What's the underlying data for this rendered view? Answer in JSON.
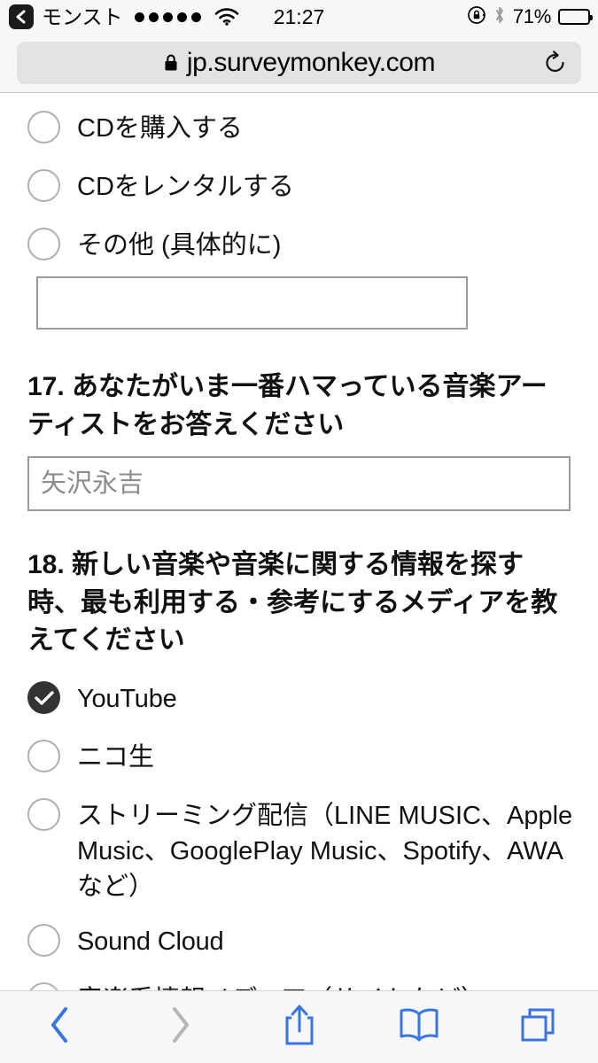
{
  "statusbar": {
    "back_app_label": "モンスト",
    "back_icon": "back-chevron-icon",
    "signal_dots": 5,
    "wifi_icon": "wifi-icon",
    "time": "21:27",
    "rotation_lock_icon": "rotation-lock-icon",
    "bluetooth_icon": "bluetooth-icon",
    "battery_percent": "71%",
    "battery_level": 71
  },
  "browser": {
    "lock_icon": "lock-icon",
    "url": "jp.surveymonkey.com",
    "reload_icon": "reload-icon"
  },
  "survey": {
    "previous_question_options": [
      {
        "label": "CDを購入する",
        "checked": false
      },
      {
        "label": "CDをレンタルする",
        "checked": false
      },
      {
        "label": "その他 (具体的に)",
        "checked": false
      }
    ],
    "other_text_value": "",
    "questions": [
      {
        "number": "17.",
        "title": "17. あなたがいま一番ハマっている音楽アーティストをお答えください",
        "input_placeholder": "矢沢永吉",
        "input_value": ""
      },
      {
        "number": "18.",
        "title": "18. 新しい音楽や音楽に関する情報を探す時、最も利用する・参考にするメディアを教えてください",
        "options": [
          {
            "label": "YouTube",
            "checked": true
          },
          {
            "label": "ニコ生",
            "checked": false
          },
          {
            "label": "ストリーミング配信（LINE MUSIC、Apple Music、GooglePlay Music、Spotify、AWAなど）",
            "checked": false
          },
          {
            "label": "Sound Cloud",
            "checked": false
          },
          {
            "label": "音楽系情報メディア（サイトなど）",
            "checked": false
          }
        ]
      }
    ]
  },
  "toolbar": {
    "back_icon": "chevron-left-icon",
    "forward_icon": "chevron-right-icon",
    "share_icon": "share-icon",
    "bookmarks_icon": "book-icon",
    "tabs_icon": "tabs-icon"
  },
  "colors": {
    "accent": "#3a76e0",
    "disabled": "#b6b6b6",
    "checked_fill": "#333333",
    "radio_border": "#b0b0b0",
    "chrome_bg": "#f7f7f7",
    "urlbar_bg": "#e3e3e5"
  }
}
